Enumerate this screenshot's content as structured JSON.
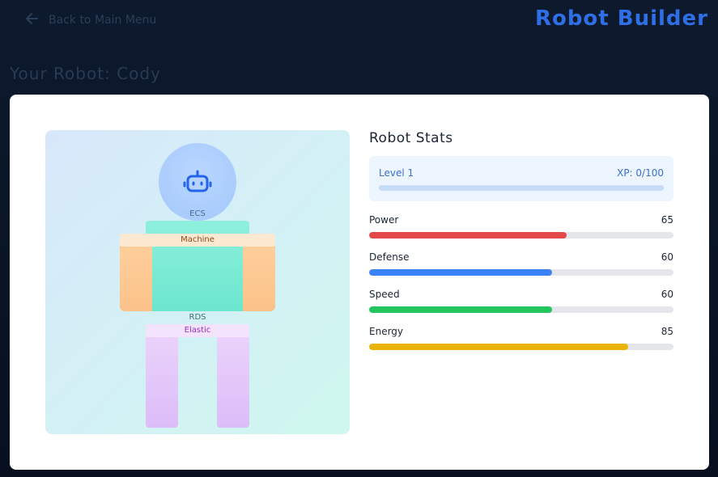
{
  "header": {
    "back_label": "Back to Main Menu",
    "app_title": "Robot Builder"
  },
  "robot": {
    "heading": "Your Robot: Cody",
    "parts": {
      "head": "ECS",
      "arms": "Machine",
      "torso": "RDS",
      "legs": "Elastic"
    }
  },
  "stats": {
    "title": "Robot Stats",
    "level_label": "Level 1",
    "xp_label": "XP: 0/100",
    "xp_fraction": 0,
    "items": [
      {
        "label": "Power",
        "value": "65",
        "fraction": 0.65,
        "color": "#e54848"
      },
      {
        "label": "Defense",
        "value": "60",
        "fraction": 0.6,
        "color": "#3b82f6"
      },
      {
        "label": "Speed",
        "value": "60",
        "fraction": 0.6,
        "color": "#22c55e"
      },
      {
        "label": "Energy",
        "value": "85",
        "fraction": 0.85,
        "color": "#eab308"
      }
    ]
  }
}
